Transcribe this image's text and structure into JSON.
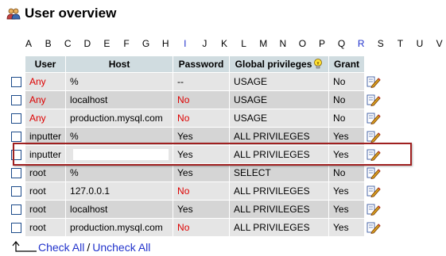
{
  "page": {
    "title": "User overview"
  },
  "alphabet": [
    {
      "letter": "A",
      "link": false
    },
    {
      "letter": "B",
      "link": false
    },
    {
      "letter": "C",
      "link": false
    },
    {
      "letter": "D",
      "link": false
    },
    {
      "letter": "E",
      "link": false
    },
    {
      "letter": "F",
      "link": false
    },
    {
      "letter": "G",
      "link": false
    },
    {
      "letter": "H",
      "link": false
    },
    {
      "letter": "I",
      "link": true
    },
    {
      "letter": "J",
      "link": false
    },
    {
      "letter": "K",
      "link": false
    },
    {
      "letter": "L",
      "link": false
    },
    {
      "letter": "M",
      "link": false
    },
    {
      "letter": "N",
      "link": false
    },
    {
      "letter": "O",
      "link": false
    },
    {
      "letter": "P",
      "link": false
    },
    {
      "letter": "Q",
      "link": false
    },
    {
      "letter": "R",
      "link": true
    },
    {
      "letter": "S",
      "link": false
    },
    {
      "letter": "T",
      "link": false
    },
    {
      "letter": "U",
      "link": false
    },
    {
      "letter": "V",
      "link": false
    }
  ],
  "table": {
    "headers": {
      "user": "User",
      "host": "Host",
      "password": "Password",
      "global_privileges": "Global privileges",
      "grant": "Grant"
    },
    "rows": [
      {
        "user": "Any",
        "user_red": true,
        "host": "%",
        "password": "--",
        "password_red": false,
        "privileges": "USAGE",
        "grant": "No"
      },
      {
        "user": "Any",
        "user_red": true,
        "host": "localhost",
        "password": "No",
        "password_red": true,
        "privileges": "USAGE",
        "grant": "No"
      },
      {
        "user": "Any",
        "user_red": true,
        "host": "production.mysql.com",
        "password": "No",
        "password_red": true,
        "privileges": "USAGE",
        "grant": "No"
      },
      {
        "user": "inputter",
        "user_red": false,
        "host": "%",
        "password": "Yes",
        "password_red": false,
        "privileges": "ALL PRIVILEGES",
        "grant": "Yes"
      },
      {
        "user": "inputter",
        "user_red": false,
        "host": "",
        "host_redacted": true,
        "password": "Yes",
        "password_red": false,
        "privileges": "ALL PRIVILEGES",
        "grant": "Yes"
      },
      {
        "user": "root",
        "user_red": false,
        "host": "%",
        "password": "Yes",
        "password_red": false,
        "privileges": "SELECT",
        "grant": "No"
      },
      {
        "user": "root",
        "user_red": false,
        "host": "127.0.0.1",
        "password": "No",
        "password_red": true,
        "privileges": "ALL PRIVILEGES",
        "grant": "Yes"
      },
      {
        "user": "root",
        "user_red": false,
        "host": "localhost",
        "password": "Yes",
        "password_red": false,
        "privileges": "ALL PRIVILEGES",
        "grant": "Yes"
      },
      {
        "user": "root",
        "user_red": false,
        "host": "production.mysql.com",
        "password": "No",
        "password_red": true,
        "privileges": "ALL PRIVILEGES",
        "grant": "Yes"
      }
    ]
  },
  "footer": {
    "check_all": "Check All",
    "separator": "/",
    "uncheck_all": "Uncheck All"
  },
  "colors": {
    "link": "#2233cc",
    "warning": "#dd0000",
    "header_bg": "#d0dce0",
    "highlight_border": "#a02020"
  },
  "icons": {
    "title": "users-icon",
    "help": "lightbulb-icon",
    "edit": "edit-pencil-icon",
    "footer": "arrow-corner-icon"
  }
}
